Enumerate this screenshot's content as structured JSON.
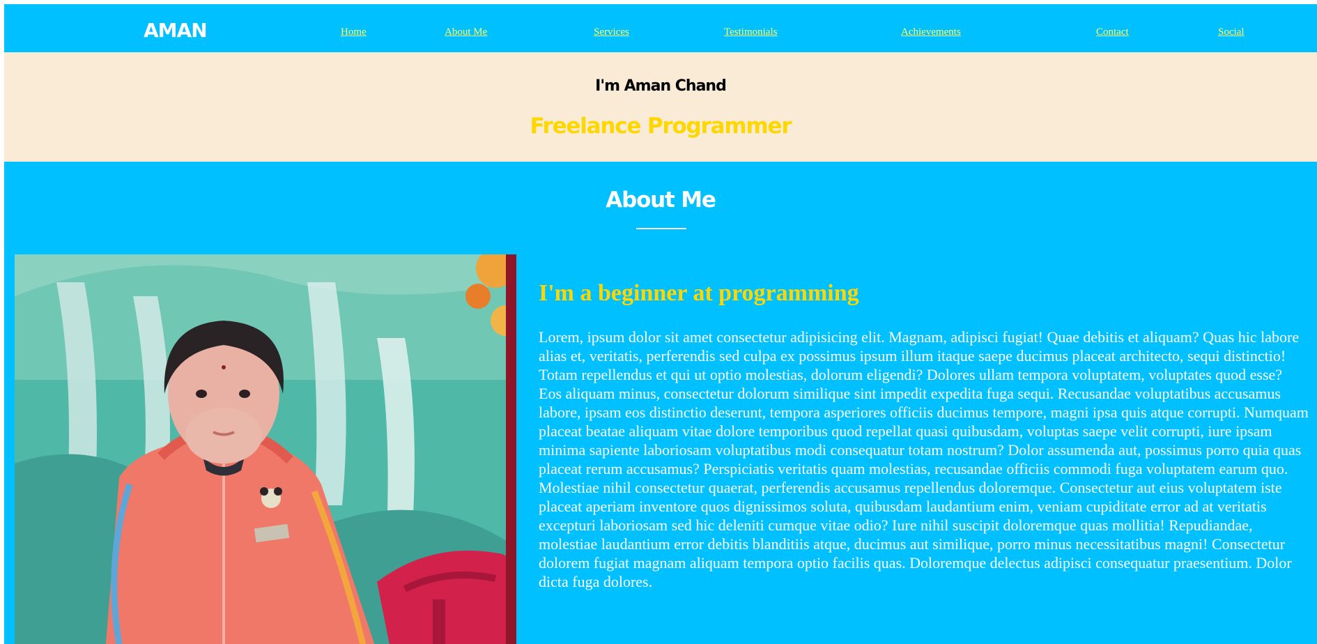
{
  "header": {
    "logo": "AMAN",
    "nav": [
      {
        "label": "Home"
      },
      {
        "label": "About Me"
      },
      {
        "label": "Services"
      },
      {
        "label": "Testimonials"
      },
      {
        "label": "Achievements"
      },
      {
        "label": "Contact"
      },
      {
        "label": "Social"
      }
    ]
  },
  "hero": {
    "name": "I'm Aman Chand",
    "role": "Freelance Programmer"
  },
  "about": {
    "title": "About Me",
    "heading": "I'm a beginner at programming",
    "text": "Lorem, ipsum dolor sit amet consectetur adipisicing elit. Magnam, adipisci fugiat! Quae debitis et aliquam? Quas hic labore alias et, veritatis, perferendis sed culpa ex possimus ipsum illum itaque saepe ducimus placeat architecto, sequi distinctio! Totam repellendus et qui ut optio molestias, dolorum eligendi? Dolores ullam tempora voluptatem, voluptates quod esse? Eos aliquam minus, consectetur dolorum similique sint impedit expedita fuga sequi. Recusandae voluptatibus accusamus labore, ipsam eos distinctio deserunt, tempora asperiores officiis ducimus tempore, magni ipsa quis atque corrupti. Numquam placeat beatae aliquam vitae dolore temporibus quod repellat quasi quibusdam, voluptas saepe velit corrupti, iure ipsam minima sapiente laboriosam voluptatibus modi consequatur totam nostrum? Dolor assumenda aut, possimus porro quia quas placeat rerum accusamus? Perspiciatis veritatis quam molestias, recusandae officiis commodi fuga voluptatem earum quo. Molestiae nihil consectetur quaerat, perferendis accusamus repellendus doloremque. Consectetur aut eius voluptatem iste placeat aperiam inventore quos dignissimos soluta, quibusdam laudantium enim, veniam cupiditate error ad at veritatis excepturi laboriosam sed hic deleniti cumque vitae odio? Iure nihil suscipit doloremque quas mollitia! Repudiandae, molestiae laudantium error debitis blanditiis atque, ducimus aut similique, porro minus necessitatibus magni! Consectetur dolorem fugiat magnam aliquam tempora optio facilis quas. Doloremque delectus adipisci consequatur praesentium. Dolor dicta fuga dolores."
  },
  "colors": {
    "accent": "#00c0ff",
    "hero_background": "#faebd7",
    "highlight": "#ffd700",
    "nav_link": "#ffff66"
  }
}
